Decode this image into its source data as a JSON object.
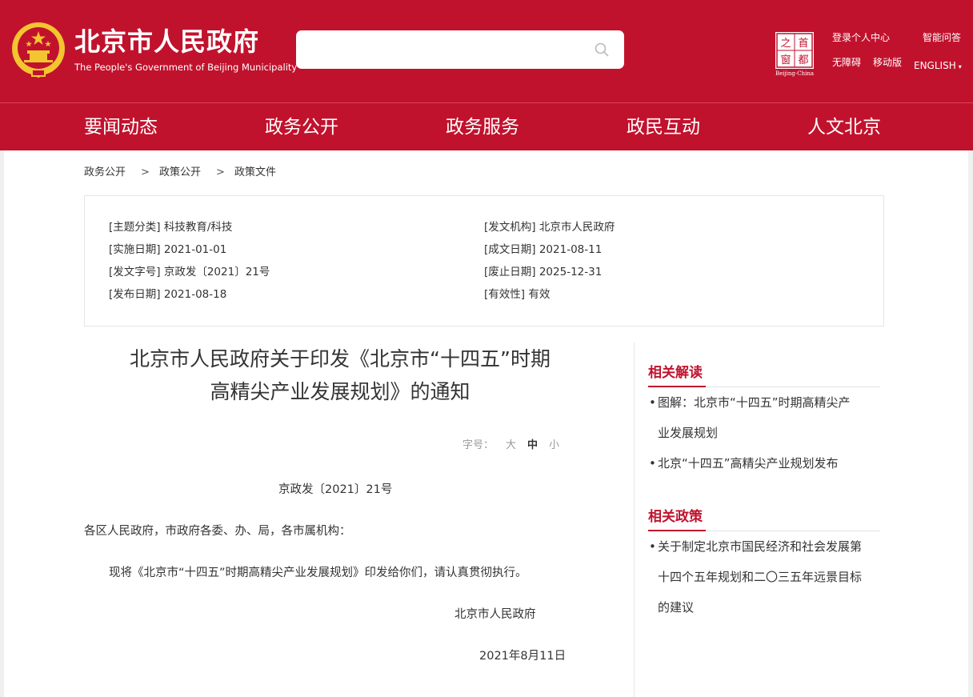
{
  "header": {
    "title": "北京市人民政府",
    "subtitle": "The People's Government of Beijing Municipality",
    "logo_text": [
      "之",
      "首",
      "窗",
      "都"
    ],
    "logo_caption": "Beijing-China",
    "links": {
      "login": "登录个人中心",
      "smart_qa": "智能问答",
      "accessibility": "无障碍",
      "mobile": "移动版",
      "english": "ENGLISH",
      "caret": "▾"
    }
  },
  "nav": [
    "要闻动态",
    "政务公开",
    "政务服务",
    "政民互动",
    "人文北京"
  ],
  "breadcrumb": {
    "items": [
      "政务公开",
      "政策公开",
      "政策文件"
    ],
    "separator": ">"
  },
  "meta": {
    "left": [
      {
        "label": "[主题分类]",
        "value": "科技教育/科技"
      },
      {
        "label": "[实施日期]",
        "value": "2021-01-01"
      },
      {
        "label": "[发文字号]",
        "value": "京政发〔2021〕21号"
      },
      {
        "label": "[发布日期]",
        "value": "2021-08-18"
      }
    ],
    "right": [
      {
        "label": "[发文机构]",
        "value": "北京市人民政府"
      },
      {
        "label": "[成文日期]",
        "value": "2021-08-11"
      },
      {
        "label": "[废止日期]",
        "value": "2025-12-31"
      },
      {
        "label": "[有效性]",
        "value": "有效"
      }
    ]
  },
  "article": {
    "title_line1": "北京市人民政府关于印发《北京市“十四五”时期",
    "title_line2": "高精尖产业发展规划》的通知",
    "font_size": {
      "label": "字号：",
      "large": "大",
      "medium": "中",
      "small": "小"
    },
    "doc_number": "京政发〔2021〕21号",
    "addressee": "各区人民政府，市政府各委、办、局，各市属机构：",
    "body": "现将《北京市“十四五”时期高精尖产业发展规划》印发给你们，请认真贯彻执行。",
    "signature": "北京市人民政府",
    "date": "2021年8月11日"
  },
  "sidebar": {
    "related_readings": {
      "title": "相关解读",
      "items": [
        {
          "lines": [
            "图解：北京市“十四五”时期高精尖产",
            "业发展规划"
          ]
        },
        {
          "lines": [
            "北京“十四五”高精尖产业规划发布"
          ]
        }
      ]
    },
    "related_policies": {
      "title": "相关政策",
      "items": [
        {
          "lines": [
            "关于制定北京市国民经济和社会发展第",
            "十四个五年规划和二〇三五年远景目标",
            "的建议"
          ]
        }
      ]
    },
    "bullet": "•"
  },
  "colors": {
    "brand_red": "#c1122d",
    "emblem_gold": "#f4c531",
    "text": "#333333",
    "muted": "#999999"
  },
  "icons": {
    "emblem": "national-emblem-icon",
    "search": "search-icon",
    "capital_logo": "capital-window-logo"
  }
}
